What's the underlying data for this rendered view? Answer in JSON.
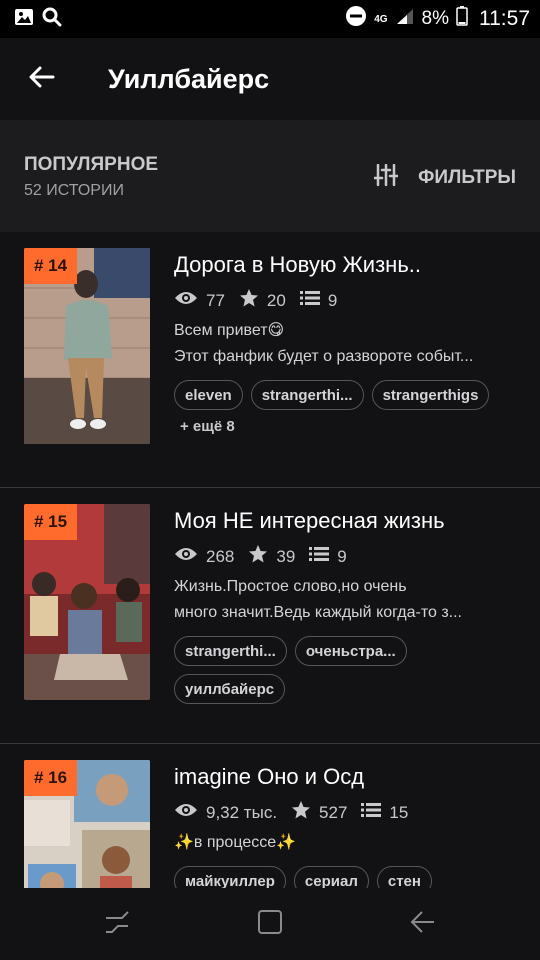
{
  "status_bar": {
    "network": "4G",
    "battery": "8%",
    "time": "11:57"
  },
  "app_bar": {
    "title": "Уиллбайерс"
  },
  "section": {
    "title": "ПОПУЛЯРНОЕ",
    "count": "52 ИСТОРИИ",
    "filters_label": "ФИЛЬТРЫ"
  },
  "stories": [
    {
      "rank": "# 14",
      "title": "Дорога в Новую Жизнь..",
      "views": "77",
      "votes": "20",
      "parts": "9",
      "desc_line1": "Всем привет😋",
      "desc_line2": "Этот фанфик будет о развороте событ...",
      "tags": [
        "eleven",
        "strangerthi...",
        "strangerthigs"
      ],
      "more": "+ ещё 8"
    },
    {
      "rank": "# 15",
      "title": "Моя НЕ интересная жизнь",
      "views": "268",
      "votes": "39",
      "parts": "9",
      "desc_line1": "Жизнь.Простое слово,но очень",
      "desc_line2": "много значит.Ведь каждый когда-то з...",
      "tags": [
        "strangerthi...",
        "оченьстра...",
        "уиллбайерс"
      ]
    },
    {
      "rank": "# 16",
      "title": "imagine Оно и Осд",
      "views": "9,32 тыс.",
      "votes": "527",
      "parts": "15",
      "desc_line1": "✨в процессе✨",
      "tags": [
        "майкуиллер",
        "сериал",
        "стен"
      ]
    }
  ]
}
